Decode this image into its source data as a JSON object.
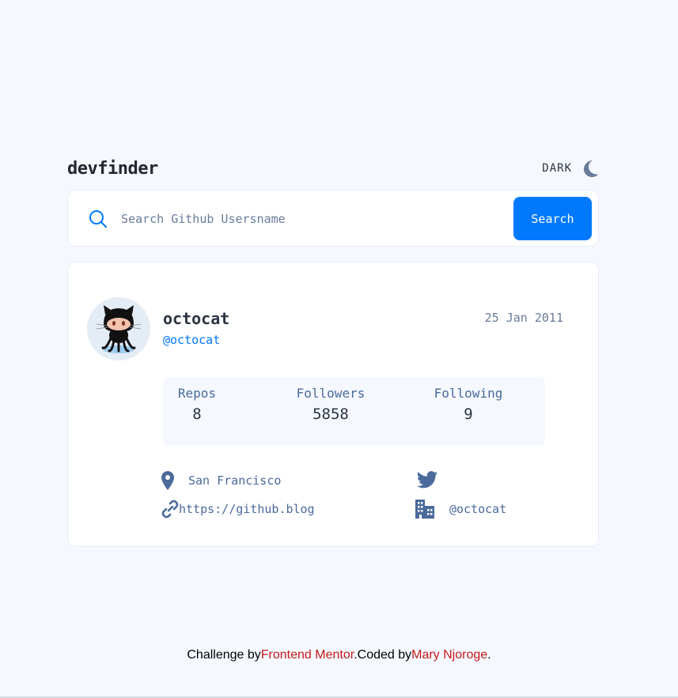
{
  "header": {
    "logo": "devfinder",
    "theme_label": "DARK",
    "theme_icon": "moon-icon"
  },
  "search": {
    "placeholder": "Search Github Usersname",
    "value": "",
    "button_label": "Search",
    "icon": "search-icon"
  },
  "profile": {
    "name": "octocat",
    "login": "@octocat",
    "joined": "25 Jan 2011",
    "avatar": "octocat-avatar"
  },
  "stats": {
    "repos_label": "Repos",
    "repos": "8",
    "followers_label": "Followers",
    "followers": "5858",
    "following_label": "Following",
    "following": "9"
  },
  "links": {
    "location": "San Francisco",
    "location_icon": "location-pin-icon",
    "blog": "https://github.blog",
    "blog_icon": "link-icon",
    "twitter": "",
    "twitter_icon": "twitter-icon",
    "company": "@octocat",
    "company_icon": "building-icon"
  },
  "footer": {
    "challenge_prefix": "Challenge by",
    "challenge_link": "Frontend Mentor",
    "coded_prefix": ".Coded by",
    "coded_link": "Mary Njoroge",
    "suffix": "."
  },
  "colors": {
    "background": "#f5f8ff",
    "accent": "#0079ff",
    "text": "#2b3442",
    "muted": "#697c9a",
    "icon": "#4b6a9b",
    "footer_link": "#c41a1a"
  }
}
